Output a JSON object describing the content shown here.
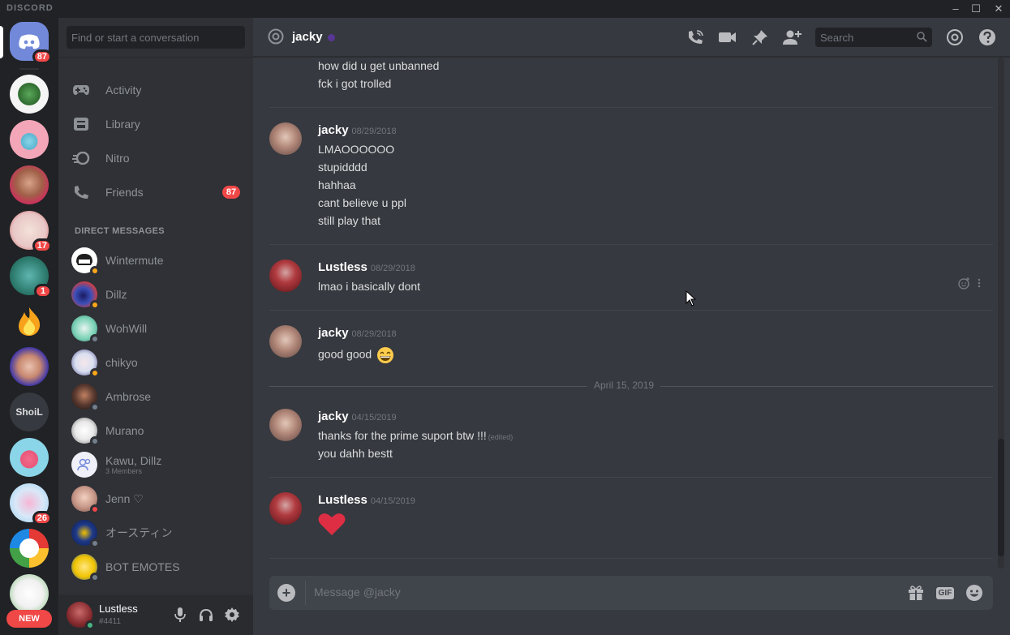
{
  "window": {
    "brand": "DISCORD",
    "controls": [
      "–",
      "☐",
      "✕"
    ]
  },
  "guilds": {
    "home_badge": "87",
    "items": [
      {
        "name": "frog-server",
        "badge": ""
      },
      {
        "name": "strawberry-server",
        "badge": ""
      },
      {
        "name": "face-server",
        "badge": ""
      },
      {
        "name": "pixel-server",
        "badge": "17"
      },
      {
        "name": "pokemon-server",
        "badge": "1"
      },
      {
        "name": "fire-server",
        "badge": ""
      },
      {
        "name": "girl-server",
        "badge": ""
      },
      {
        "name": "ShoiL",
        "badge": ""
      },
      {
        "name": "pink-strawberry-server",
        "badge": ""
      },
      {
        "name": "his-server",
        "badge": "26"
      },
      {
        "name": "colorful-ring-server",
        "badge": ""
      },
      {
        "name": "cartoon-server",
        "badge": ""
      }
    ],
    "shoil_label": "ShoiL",
    "new_label": "NEW"
  },
  "sidebar": {
    "search_placeholder": "Find or start a conversation",
    "nav": [
      {
        "label": "Activity"
      },
      {
        "label": "Library"
      },
      {
        "label": "Nitro"
      },
      {
        "label": "Friends",
        "badge": "87"
      }
    ],
    "dm_header": "DIRECT MESSAGES",
    "dms": [
      {
        "name": "Wintermute",
        "sub": "",
        "status": "#faa61a",
        "color": "#ffffff"
      },
      {
        "name": "Dillz",
        "sub": "",
        "status": "#faa61a",
        "color": "#3b4fb8"
      },
      {
        "name": "WohWill",
        "sub": "",
        "status": "#747f8d",
        "color": "#7ed3b8"
      },
      {
        "name": "chikyo",
        "sub": "",
        "status": "#faa61a",
        "color": "#d9dff0"
      },
      {
        "name": "Ambrose",
        "sub": "",
        "status": "#747f8d",
        "color": "#5a3a30"
      },
      {
        "name": "Murano",
        "sub": "",
        "status": "#747f8d",
        "color": "#e8e8e8"
      },
      {
        "name": "Kawu, Dillz",
        "sub": "3 Members",
        "status": "",
        "color": "#f0f0f8"
      },
      {
        "name": "Jenn ♡",
        "sub": "",
        "status": "#f04747",
        "color": "#c99a8a"
      },
      {
        "name": "オースティン",
        "sub": "",
        "status": "#747f8d",
        "color": "#1f3a8a"
      },
      {
        "name": "BOT EMOTES",
        "sub": "",
        "status": "#747f8d",
        "color": "#f0c400"
      }
    ],
    "user": {
      "name": "Lustless",
      "tag": "#4411"
    }
  },
  "chat": {
    "channel_name": "jacky",
    "search_placeholder": "Search",
    "composer_placeholder": "Message @jacky",
    "composer_gif": "GIF",
    "date_divider": "April 15, 2019",
    "top_lines": [
      "how did u get unbanned",
      "fck i got trolled"
    ],
    "groups": [
      {
        "author": "jacky",
        "time": "08/29/2018",
        "avatar": "jacky",
        "lines": [
          "LMAOOOOOO",
          "stupidddd",
          "hahhaa",
          "cant believe u ppl",
          "still play that"
        ]
      },
      {
        "author": "Lustless",
        "time": "08/29/2018",
        "avatar": "lust",
        "lines": [
          "lmao i basically dont"
        ]
      },
      {
        "author": "jacky",
        "time": "08/29/2018",
        "avatar": "jacky",
        "lines": [
          "good good"
        ],
        "emoji": "grinning-emoji"
      },
      {
        "author": "jacky",
        "time": "04/15/2019",
        "avatar": "jacky",
        "lines": [
          "thanks for the prime suport btw !!!",
          "you dahh bestt"
        ],
        "edited": "(edited)"
      },
      {
        "author": "Lustless",
        "time": "04/15/2019",
        "avatar": "lust",
        "lines": [],
        "emoji": "heart-emoji"
      }
    ]
  },
  "colors": {
    "accent": "#7289da",
    "badge": "#f04747",
    "online": "#43b581",
    "idle": "#faa61a",
    "offline": "#747f8d"
  }
}
